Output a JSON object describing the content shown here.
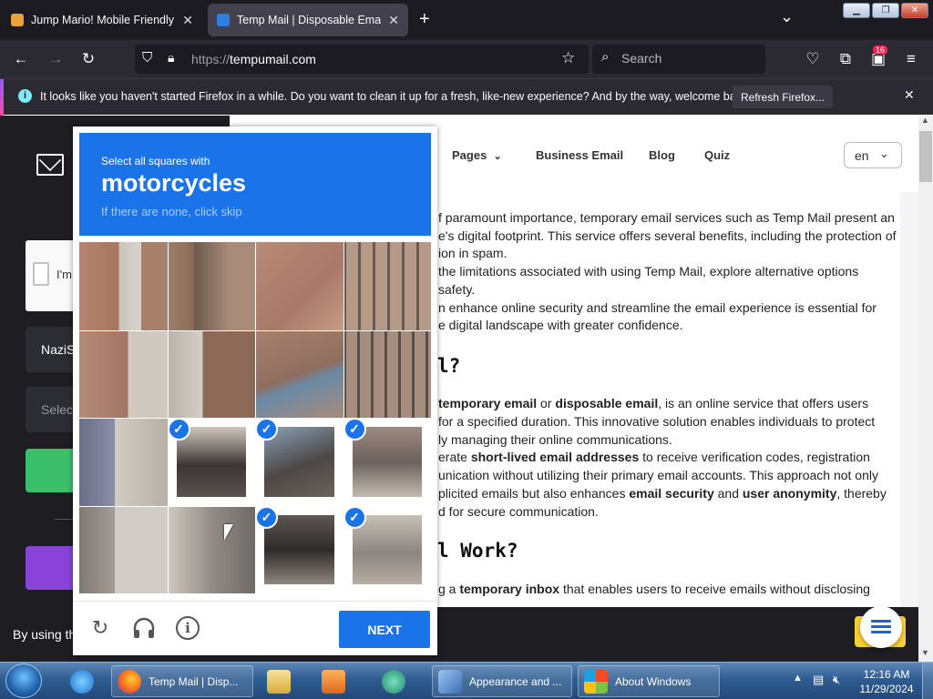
{
  "browser": {
    "tabs": [
      {
        "label": "Jump Mario! Mobile Friendly G...",
        "active": false
      },
      {
        "label": "Temp Mail | Disposable Email A...",
        "active": true
      }
    ],
    "new_tab": "+",
    "tab_list": "⌄",
    "url_prefix": "https://",
    "url_host": "tempumail.com",
    "search_placeholder": "Search",
    "extension_badge": "16"
  },
  "notification": {
    "message": "It looks like you haven't started Firefox in a while. Do you want to clean it up for a fresh, like-new experience? And by the way, welcome back!",
    "button": "Refresh Firefox...",
    "close": "✕"
  },
  "site": {
    "nav": [
      "Pages",
      "Business Email",
      "Blog",
      "Quiz"
    ],
    "language": "en",
    "left_checkbox_text": "I'm",
    "left_field1": "NaziS",
    "left_field2": "Selec",
    "footer_text": "By using th"
  },
  "article": {
    "lines": [
      "f paramount importance, temporary email services such as Temp Mail present an",
      "e's digital footprint. This service offers several benefits, including the protection of",
      "ion in spam.",
      "the limitations associated with using Temp Mail, explore alternative options",
      "safety.",
      "n enhance online security and streamline the email experience is essential for",
      "e digital landscape with greater confidence."
    ],
    "heading1": "l?",
    "para2": [
      [
        {
          "t": "temporary email",
          "b": true
        },
        {
          "t": " or "
        },
        {
          "t": "disposable email",
          "b": true
        },
        {
          "t": ", is an online service that offers users"
        }
      ],
      [
        {
          "t": "for a specified duration. This innovative solution enables individuals to protect"
        }
      ],
      [
        {
          "t": "ly managing their online communications."
        }
      ],
      [
        {
          "t": "erate "
        },
        {
          "t": "short-lived email addresses",
          "b": true
        },
        {
          "t": " to receive verification codes, registration"
        }
      ],
      [
        {
          "t": "unication without utilizing their primary email accounts. This approach not only"
        }
      ],
      [
        {
          "t": "plicited emails but also enhances "
        },
        {
          "t": "email security",
          "b": true
        },
        {
          "t": " and "
        },
        {
          "t": "user anonymity",
          "b": true
        },
        {
          "t": ", thereby"
        }
      ],
      [
        {
          "t": "d for secure communication."
        }
      ]
    ],
    "heading2": "l Work?",
    "para3": [
      [
        {
          "t": "g a "
        },
        {
          "t": "temporary inbox",
          "b": true
        },
        {
          "t": " that enables users to receive emails without disclosing"
        }
      ]
    ]
  },
  "captcha": {
    "instruction_small": "Select all squares with",
    "target": "motorcycles",
    "hint": "If there are none, click skip",
    "cells": [
      {
        "selected": false
      },
      {
        "selected": false
      },
      {
        "selected": false
      },
      {
        "selected": false
      },
      {
        "selected": false
      },
      {
        "selected": false
      },
      {
        "selected": false
      },
      {
        "selected": false
      },
      {
        "selected": false
      },
      {
        "selected": true
      },
      {
        "selected": true
      },
      {
        "selected": true
      },
      {
        "selected": false
      },
      {
        "selected": false
      },
      {
        "selected": true
      },
      {
        "selected": true
      }
    ],
    "check_glyph": "✓",
    "next_label": "NEXT",
    "reload_icon": "↻",
    "info_icon": "i"
  },
  "taskbar": {
    "items": [
      "Temp Mail | Disp...",
      "Appearance and ...",
      "About Windows"
    ],
    "time": "12:16 AM",
    "date": "11/29/2024"
  }
}
